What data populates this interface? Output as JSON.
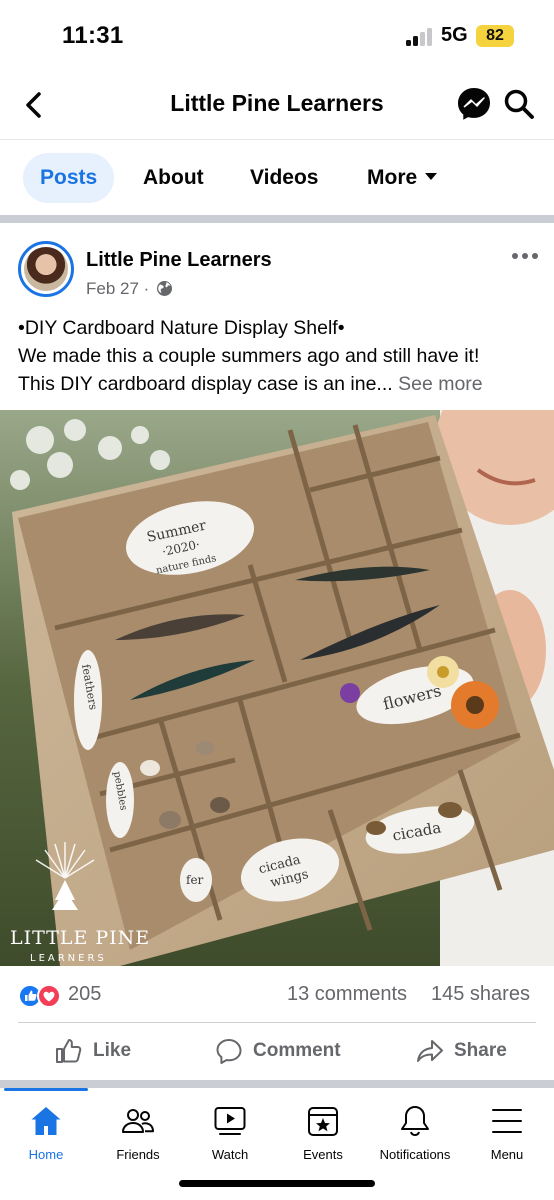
{
  "status_bar": {
    "time": "11:31",
    "network": "5G",
    "battery": "82"
  },
  "header": {
    "title": "Little Pine Learners",
    "back_icon": "chevron-left-icon",
    "messenger_icon": "messenger-icon",
    "search_icon": "search-icon"
  },
  "tabs": [
    {
      "label": "Posts",
      "active": true
    },
    {
      "label": "About",
      "active": false
    },
    {
      "label": "Videos",
      "active": false
    },
    {
      "label": "More",
      "active": false
    }
  ],
  "post": {
    "author": "Little Pine Learners",
    "date": "Feb 27",
    "separator": "·",
    "text_line_1": "•DIY Cardboard Nature Display Shelf•",
    "text_line_2": "We made this a couple summers ago and still have it!",
    "text_line_3": "This DIY cardboard display case is an ine... ",
    "see_more": "See more",
    "photo_labels": {
      "summer_note_1": "Summer",
      "summer_note_2": "·2020·",
      "summer_note_3": "nature finds",
      "feathers": "feathers",
      "flowers": "flowers",
      "cicada": "cicada",
      "cicada_wings_1": "cicada",
      "cicada_wings_2": "wings",
      "pebbles": "pebbles",
      "ferns": "fer",
      "watermark_1": "LITTLE PINE",
      "watermark_2": "LEARNERS"
    }
  },
  "engagement": {
    "reaction_count": "205",
    "comments": "13 comments",
    "shares": "145 shares"
  },
  "actions": [
    {
      "label": "Like",
      "icon": "thumbs-up-icon"
    },
    {
      "label": "Comment",
      "icon": "comment-icon"
    },
    {
      "label": "Share",
      "icon": "share-icon"
    }
  ],
  "bottom_nav": [
    {
      "label": "Home",
      "icon": "home-icon",
      "active": true
    },
    {
      "label": "Friends",
      "icon": "friends-icon",
      "active": false
    },
    {
      "label": "Watch",
      "icon": "watch-icon",
      "active": false
    },
    {
      "label": "Events",
      "icon": "events-icon",
      "active": false
    },
    {
      "label": "Notifications",
      "icon": "bell-icon",
      "active": false
    },
    {
      "label": "Menu",
      "icon": "menu-icon",
      "active": false
    }
  ],
  "colors": {
    "accent": "#1b74e4",
    "secondary_text": "#65676b",
    "battery": "#f5d33f"
  }
}
